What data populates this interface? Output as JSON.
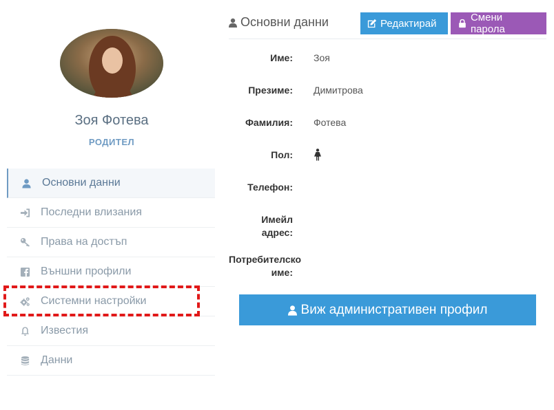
{
  "profile": {
    "name": "Зоя Фотева",
    "role": "РОДИТЕЛ"
  },
  "menu": {
    "items": [
      {
        "label": "Основни данни",
        "icon": "user-icon",
        "active": true
      },
      {
        "label": "Последни влизания",
        "icon": "sign-in-icon",
        "active": false
      },
      {
        "label": "Права на достъп",
        "icon": "key-icon",
        "active": false
      },
      {
        "label": "Външни профили",
        "icon": "facebook-icon",
        "active": false
      },
      {
        "label": "Системни настройки",
        "icon": "cogs-icon",
        "active": false
      },
      {
        "label": "Известия",
        "icon": "bell-icon",
        "active": false
      },
      {
        "label": "Данни",
        "icon": "database-icon",
        "active": false
      }
    ]
  },
  "details": {
    "title": "Основни данни",
    "edit_label": "Редактирай",
    "password_label": "Смени парола",
    "fields": [
      {
        "label": "Име:",
        "value": "Зоя"
      },
      {
        "label": "Презиме:",
        "value": "Димитрова"
      },
      {
        "label": "Фамилия:",
        "value": "Фотева"
      },
      {
        "label": "Пол:",
        "value": ""
      },
      {
        "label": "Телефон:",
        "value": ""
      },
      {
        "label": "Имейл адрес:",
        "value": ""
      },
      {
        "label": "Потребителско име:",
        "value": ""
      }
    ],
    "gender_icon": "female-icon",
    "admin_button_label": "Виж административен профил"
  },
  "colors": {
    "primary": "#3a9ad9",
    "purple": "#9b59b6",
    "highlight": "#e11919",
    "accent": "#6f9bc3"
  }
}
